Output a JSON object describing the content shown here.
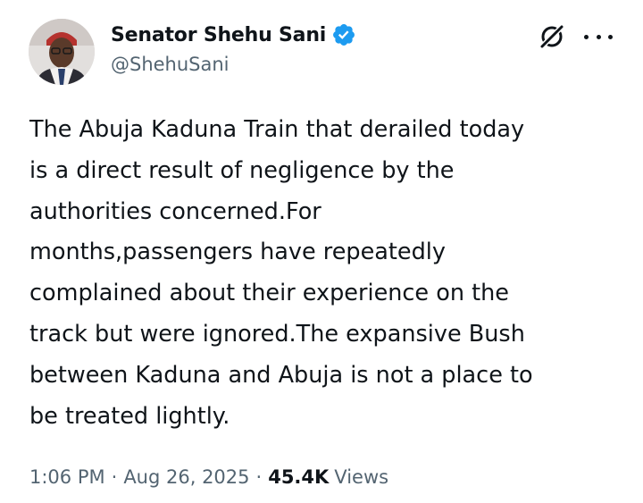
{
  "author": {
    "display_name": "Senator Shehu Sani",
    "handle": "@ShehuSani",
    "verified": true,
    "verified_color": "#1d9bf0"
  },
  "header_icons": [
    "grok-icon",
    "more-options-icon"
  ],
  "tweet": {
    "lines": [
      "The Abuja Kaduna Train that derailed today",
      "is a direct result of negligence by the",
      "authorities concerned.For",
      "months,passengers have repeatedly",
      "complained about their experience on the",
      "track but were ignored.The expansive Bush",
      "between Kaduna and Abuja is not a place to",
      "be treated lightly."
    ]
  },
  "meta": {
    "time": "1:06 PM",
    "separator": "·",
    "date": "Aug 26, 2025",
    "views_count": "45.4K",
    "views_label": "Views"
  },
  "colors": {
    "text": "#0f1419",
    "secondary": "#536471",
    "accent": "#1d9bf0"
  }
}
